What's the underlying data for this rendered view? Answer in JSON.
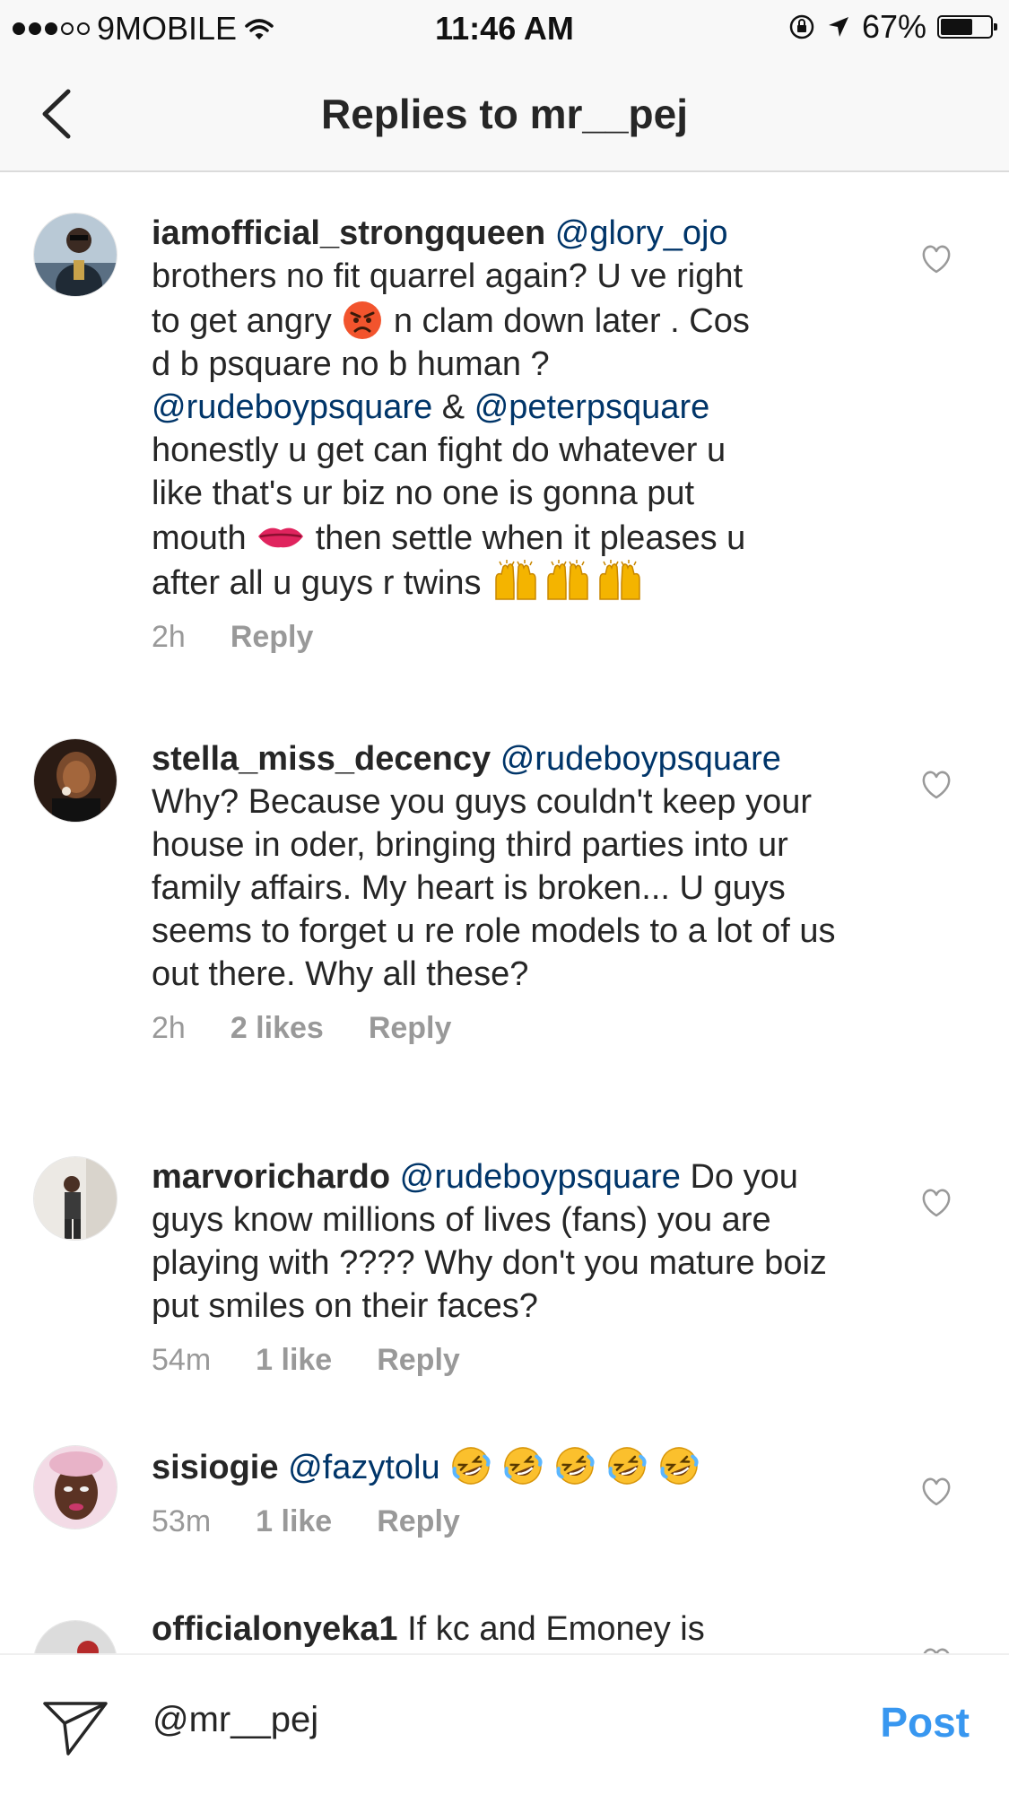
{
  "status_bar": {
    "carrier": "9MOBILE",
    "time": "11:46 AM",
    "battery": "67%",
    "signal_bars_filled": 3,
    "signal_bars_total": 5,
    "battery_level": 0.67
  },
  "nav": {
    "title": "Replies to mr__pej"
  },
  "comments": [
    {
      "username": "iamofficial_strongqueen",
      "mention": "@glory_ojo",
      "line1": "brothers no fit quarrel again? U ve right",
      "line2a": "to get angry",
      "line2b": "n clam down later . Cos",
      "line3": "d b psquare no b human ?",
      "mention2": "@rudeboypsquare",
      "amp": "&",
      "mention3": "@peterpsquare",
      "line5": "honestly u get can fight do whatever u",
      "line6": "like that's ur biz no one is gonna put",
      "line7a": "mouth",
      "line7b": "then settle when it pleases u",
      "line8": "after all u guys r twins",
      "time": "2h",
      "reply": "Reply"
    },
    {
      "username": "stella_miss_decency",
      "mention": "@rudeboypsquare",
      "text": "Why?  Because you guys couldn't keep your house in oder, bringing third parties into ur family affairs. My heart is broken... U guys seems to forget u re role models to a lot of us out there. Why all these?",
      "time": "2h",
      "likes": "2 likes",
      "reply": "Reply"
    },
    {
      "username": "marvorichardo",
      "mention": "@rudeboypsquare",
      "text": "Do you guys know millions of lives (fans) you are playing with ???? Why don't you mature boiz put smiles on their faces?",
      "time": "54m",
      "likes": "1 like",
      "reply": "Reply"
    },
    {
      "username": "sisiogie",
      "mention": "@fazytolu",
      "time": "53m",
      "likes": "1 like",
      "reply": "Reply"
    },
    {
      "username": "officialonyeka1",
      "text": "If kc and Emoney is"
    }
  ],
  "composer": {
    "value": "@mr__pej",
    "post": "Post"
  },
  "colors": {
    "text": "#262626",
    "mention": "#003569",
    "meta": "#999999",
    "post": "#3897f0",
    "bar": "#f8f8f8"
  },
  "icons": [
    "chevron-left-icon",
    "heart-icon",
    "send-icon",
    "wifi-icon",
    "orientation-lock-icon",
    "location-arrow-icon",
    "battery-icon"
  ]
}
